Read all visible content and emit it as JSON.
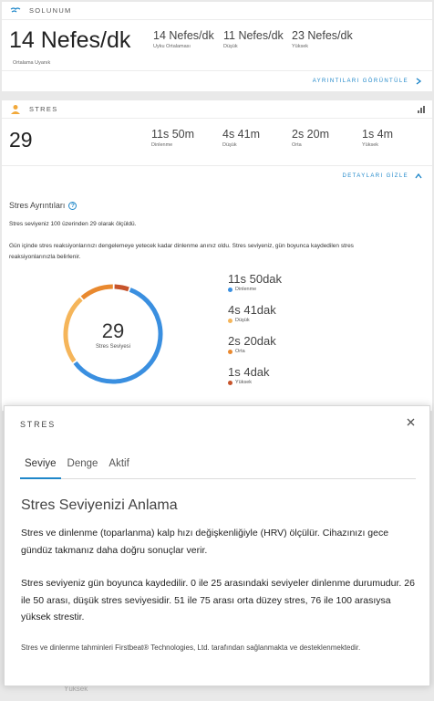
{
  "respiration": {
    "header": "SOLUNUM",
    "main_value": "14 Nefes/dk",
    "main_label": "Ortalama Uyanık",
    "stats": [
      {
        "value": "14 Nefes/dk",
        "label": "Uyku Ortalaması"
      },
      {
        "value": "11 Nefes/dk",
        "label": "Düşük"
      },
      {
        "value": "23 Nefes/dk",
        "label": "Yüksek"
      }
    ],
    "link": "AYRINTILARI GÖRÜNTÜLE"
  },
  "stress": {
    "header": "STRES",
    "main_value": "29",
    "stats": [
      {
        "value": "11s 50m",
        "label": "Dinlenme"
      },
      {
        "value": "4s 41m",
        "label": "Düşük"
      },
      {
        "value": "2s 20m",
        "label": "Orta"
      },
      {
        "value": "1s 4m",
        "label": "Yüksek"
      }
    ],
    "link": "DETAYLARI GİZLE",
    "details_title": "Stres Ayrıntıları",
    "paragraph1": "Stres seviyeniz 100 üzerinden 29 olarak ölçüldü.",
    "paragraph2": "Gün içinde stres reaksiyonlarınızı dengelemeye yetecek kadar dinlenme anınız oldu. Stres seviyeniz, gün boyunca kaydedilen stres reaksiyonlarınızla belirlenir.",
    "donut_value": "29",
    "donut_label": "Stres Seviyesi",
    "legend": [
      {
        "value": "11s 50dak",
        "label": "Dinlenme"
      },
      {
        "value": "4s 41dak",
        "label": "Düşük"
      },
      {
        "value": "2s 20dak",
        "label": "Orta"
      },
      {
        "value": "1s 4dak",
        "label": "Yüksek"
      }
    ],
    "colors": {
      "rest": "#3a8fe0",
      "low": "#f5b55a",
      "medium": "#e9892f",
      "high": "#c7542b"
    }
  },
  "modal": {
    "title": "STRES",
    "tabs": [
      "Seviye",
      "Denge",
      "Aktif"
    ],
    "heading": "Stres Seviyenizi Anlama",
    "p1": "Stres ve dinlenme (toparlanma) kalp hızı değişkenliğiyle (HRV) ölçülür. Cihazınızı gece gündüz takmanız daha doğru sonuçlar verir.",
    "p2": "Stres seviyeniz gün boyunca kaydedilir. 0 ile 25 arasındaki seviyeler dinlenme durumudur. 26 ile 50 arası, düşük stres seviyesidir. 51 ile 75 arası orta düzey stres, 76 ile 100 arasıysa yüksek strestir.",
    "footnote": "Stres ve dinlenme tahminleri Firstbeat® Technologies, Ltd. tarafından sağlanmakta ve desteklenmektedir."
  },
  "underlay_text": "Yüksek",
  "accent": "#1f87c9"
}
